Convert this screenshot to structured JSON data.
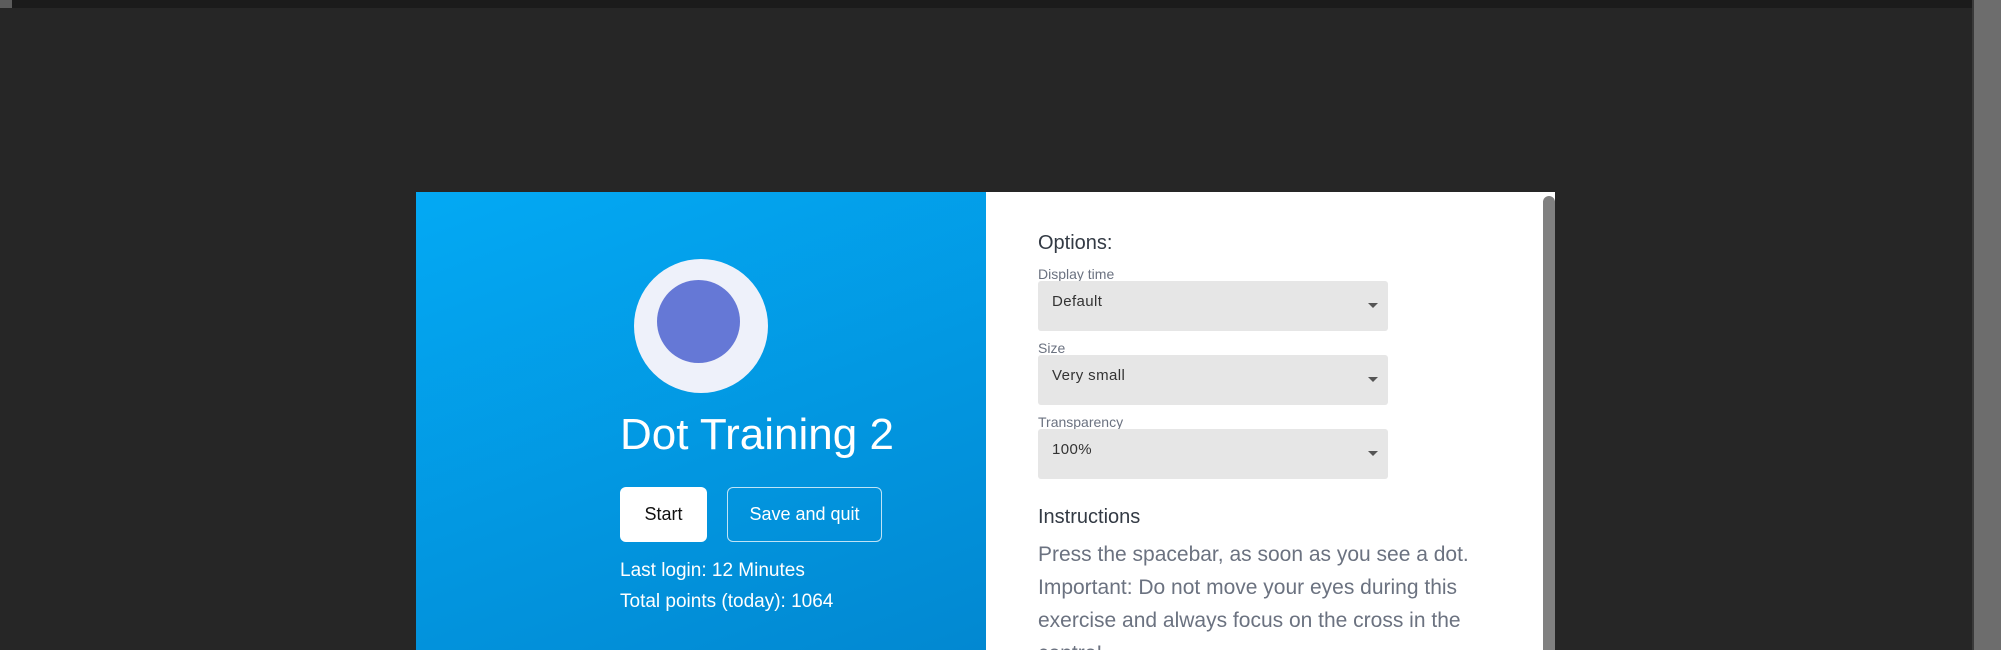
{
  "app": {
    "title": "Dot Training 2",
    "start_label": "Start",
    "save_quit_label": "Save and quit",
    "last_login": "Last login: 12 Minutes",
    "total_points": "Total points (today): 1064"
  },
  "options": {
    "heading": "Options:",
    "fields": [
      {
        "label": "Display time",
        "value": "Default"
      },
      {
        "label": "Size",
        "value": "Very small"
      },
      {
        "label": "Transparency",
        "value": "100%"
      }
    ]
  },
  "instructions": {
    "heading": "Instructions",
    "text": "Press the spacebar, as soon as you see a dot. Important: Do not move your eyes during this exercise and always focus on the cross in the centre!"
  },
  "colors": {
    "panel_gradient_start": "#03a9f4",
    "panel_gradient_end": "#0288d1",
    "logo_dot": "#6578d6",
    "logo_ring": "#eef1fa",
    "page_background": "#262626"
  },
  "icons": {
    "logo": "dot-target-icon",
    "select_caret": "caret-down-icon"
  }
}
